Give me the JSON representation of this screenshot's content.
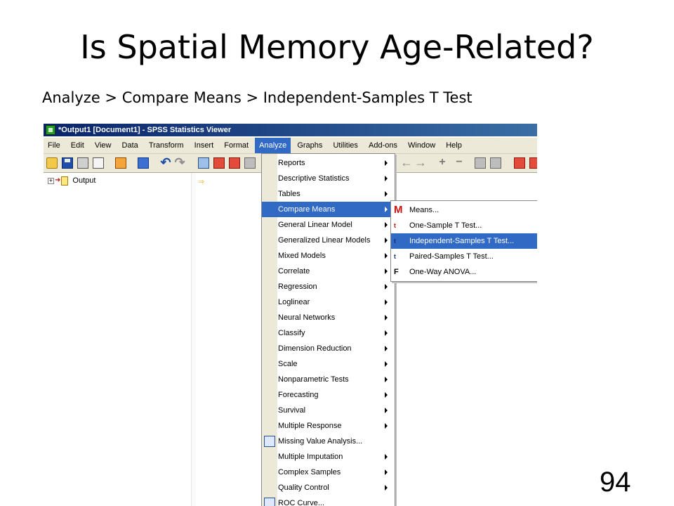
{
  "slide": {
    "title": "Is Spatial Memory Age-Related?",
    "subtitle": "Analyze > Compare Means > Independent-Samples T Test",
    "page_number": "94"
  },
  "window": {
    "title": "*Output1 [Document1] - SPSS Statistics Viewer",
    "app_icon": "spss-app-icon"
  },
  "menubar": {
    "items": [
      "File",
      "Edit",
      "View",
      "Data",
      "Transform",
      "Insert",
      "Format",
      "Analyze",
      "Graphs",
      "Utilities",
      "Add-ons",
      "Window",
      "Help"
    ],
    "active": "Analyze"
  },
  "outline": {
    "root_label": "Output",
    "expander": "+"
  },
  "analyze_menu": {
    "items": [
      {
        "label": "Reports",
        "submenu": true
      },
      {
        "label": "Descriptive Statistics",
        "submenu": true
      },
      {
        "label": "Tables",
        "submenu": true
      },
      {
        "label": "Compare Means",
        "submenu": true,
        "highlighted": true
      },
      {
        "label": "General Linear Model",
        "submenu": true
      },
      {
        "label": "Generalized Linear Models",
        "submenu": true
      },
      {
        "label": "Mixed Models",
        "submenu": true
      },
      {
        "label": "Correlate",
        "submenu": true
      },
      {
        "label": "Regression",
        "submenu": true
      },
      {
        "label": "Loglinear",
        "submenu": true
      },
      {
        "label": "Neural Networks",
        "submenu": true
      },
      {
        "label": "Classify",
        "submenu": true
      },
      {
        "label": "Dimension Reduction",
        "submenu": true
      },
      {
        "label": "Scale",
        "submenu": true
      },
      {
        "label": "Nonparametric Tests",
        "submenu": true
      },
      {
        "label": "Forecasting",
        "submenu": true
      },
      {
        "label": "Survival",
        "submenu": true
      },
      {
        "label": "Multiple Response",
        "submenu": true
      },
      {
        "label": "Missing Value Analysis...",
        "submenu": false,
        "icon": "missing-value-icon"
      },
      {
        "label": "Multiple Imputation",
        "submenu": true
      },
      {
        "label": "Complex Samples",
        "submenu": true
      },
      {
        "label": "Quality Control",
        "submenu": true
      },
      {
        "label": "ROC Curve...",
        "submenu": false,
        "icon": "roc-curve-icon"
      }
    ]
  },
  "compare_means_menu": {
    "items": [
      {
        "label": "Means...",
        "icon_text": "M",
        "icon": "means-icon"
      },
      {
        "label": "One-Sample T Test...",
        "icon_text": "t",
        "icon": "one-sample-t-icon"
      },
      {
        "label": "Independent-Samples T Test...",
        "icon_text": "t",
        "icon": "independent-t-icon",
        "highlighted": true
      },
      {
        "label": "Paired-Samples T Test...",
        "icon_text": "t",
        "icon": "paired-t-icon"
      },
      {
        "label": "One-Way ANOVA...",
        "icon_text": "F",
        "icon": "anova-icon"
      }
    ]
  },
  "colors": {
    "menu_highlight": "#316ac5",
    "titlebar": "#0a246a",
    "chrome": "#ece9d8"
  }
}
